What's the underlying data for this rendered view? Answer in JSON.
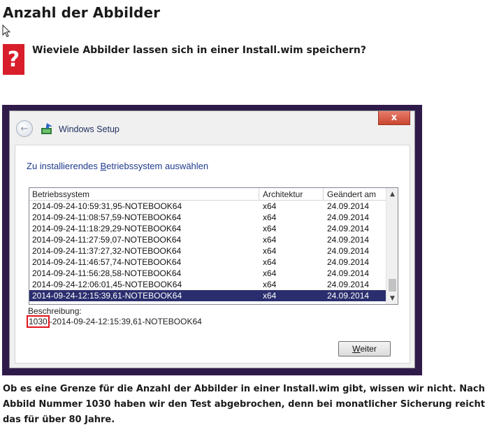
{
  "article": {
    "title": "Anzahl der Abbilder",
    "question": "Wieviele Abbilder lassen sich in einer Install.wim speichern?",
    "question_icon": "?",
    "body": "Ob es eine Grenze für die Anzahl der Abbilder in einer Install.wim gibt, wissen wir nicht. Nach Abbild Nummer 1030 haben wir den Test abgebrochen, denn bei monatlicher Sicherung reicht das für über 80 Jahre."
  },
  "setup_window": {
    "title": "Windows Setup",
    "close_glyph": "x",
    "back_glyph": "←",
    "heading_pre": "Zu installierendes ",
    "heading_accel": "B",
    "heading_post": "etriebssystem auswählen",
    "columns": [
      "Betriebssystem",
      "Architektur",
      "Geändert am"
    ],
    "rows": [
      {
        "name": "2014-09-24-10:59:31,95-NOTEBOOK64",
        "arch": "x64",
        "date": "24.09.2014",
        "selected": false
      },
      {
        "name": "2014-09-24-11:08:57,59-NOTEBOOK64",
        "arch": "x64",
        "date": "24.09.2014",
        "selected": false
      },
      {
        "name": "2014-09-24-11:18:29,29-NOTEBOOK64",
        "arch": "x64",
        "date": "24.09.2014",
        "selected": false
      },
      {
        "name": "2014-09-24-11:27:59,07-NOTEBOOK64",
        "arch": "x64",
        "date": "24.09.2014",
        "selected": false
      },
      {
        "name": "2014-09-24-11:37:27,32-NOTEBOOK64",
        "arch": "x64",
        "date": "24.09.2014",
        "selected": false
      },
      {
        "name": "2014-09-24-11:46:57,74-NOTEBOOK64",
        "arch": "x64",
        "date": "24.09.2014",
        "selected": false
      },
      {
        "name": "2014-09-24-11:56:28,58-NOTEBOOK64",
        "arch": "x64",
        "date": "24.09.2014",
        "selected": false
      },
      {
        "name": "2014-09-24-12:06:01,45-NOTEBOOK64",
        "arch": "x64",
        "date": "24.09.2014",
        "selected": false
      },
      {
        "name": "2014-09-24-12:15:39,61-NOTEBOOK64",
        "arch": "x64",
        "date": "24.09.2014",
        "selected": true
      }
    ],
    "scroll_up": "▲",
    "scroll_down": "▼",
    "description_label": "Beschreibung:",
    "description_number": "1030",
    "description_text": "-2014-09-24-12:15:39,61-NOTEBOOK64",
    "next_accel": "W",
    "next_rest": "eiter"
  },
  "colors": {
    "badge": "#d71e2a",
    "highlight_box": "#e1141d",
    "selection": "#2b2e6e",
    "frame": "#2f1b4a"
  },
  "icons": [
    "question-mark-icon",
    "mouse-pointer-icon",
    "back-arrow-icon",
    "windows-setup-icon",
    "close-icon"
  ]
}
